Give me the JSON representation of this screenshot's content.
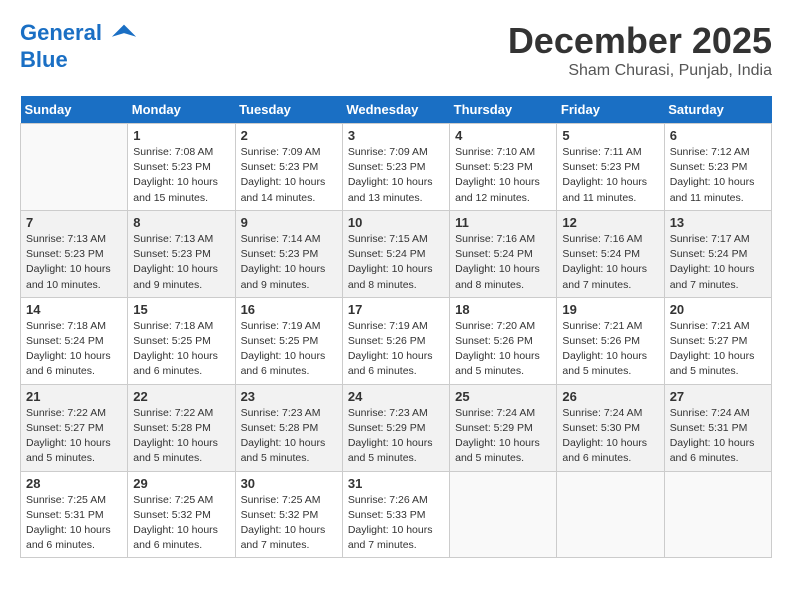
{
  "header": {
    "logo_line1": "General",
    "logo_line2": "Blue",
    "month": "December 2025",
    "location": "Sham Churasi, Punjab, India"
  },
  "days_of_week": [
    "Sunday",
    "Monday",
    "Tuesday",
    "Wednesday",
    "Thursday",
    "Friday",
    "Saturday"
  ],
  "weeks": [
    [
      {
        "num": "",
        "info": ""
      },
      {
        "num": "1",
        "info": "Sunrise: 7:08 AM\nSunset: 5:23 PM\nDaylight: 10 hours\nand 15 minutes."
      },
      {
        "num": "2",
        "info": "Sunrise: 7:09 AM\nSunset: 5:23 PM\nDaylight: 10 hours\nand 14 minutes."
      },
      {
        "num": "3",
        "info": "Sunrise: 7:09 AM\nSunset: 5:23 PM\nDaylight: 10 hours\nand 13 minutes."
      },
      {
        "num": "4",
        "info": "Sunrise: 7:10 AM\nSunset: 5:23 PM\nDaylight: 10 hours\nand 12 minutes."
      },
      {
        "num": "5",
        "info": "Sunrise: 7:11 AM\nSunset: 5:23 PM\nDaylight: 10 hours\nand 11 minutes."
      },
      {
        "num": "6",
        "info": "Sunrise: 7:12 AM\nSunset: 5:23 PM\nDaylight: 10 hours\nand 11 minutes."
      }
    ],
    [
      {
        "num": "7",
        "info": "Sunrise: 7:13 AM\nSunset: 5:23 PM\nDaylight: 10 hours\nand 10 minutes."
      },
      {
        "num": "8",
        "info": "Sunrise: 7:13 AM\nSunset: 5:23 PM\nDaylight: 10 hours\nand 9 minutes."
      },
      {
        "num": "9",
        "info": "Sunrise: 7:14 AM\nSunset: 5:23 PM\nDaylight: 10 hours\nand 9 minutes."
      },
      {
        "num": "10",
        "info": "Sunrise: 7:15 AM\nSunset: 5:24 PM\nDaylight: 10 hours\nand 8 minutes."
      },
      {
        "num": "11",
        "info": "Sunrise: 7:16 AM\nSunset: 5:24 PM\nDaylight: 10 hours\nand 8 minutes."
      },
      {
        "num": "12",
        "info": "Sunrise: 7:16 AM\nSunset: 5:24 PM\nDaylight: 10 hours\nand 7 minutes."
      },
      {
        "num": "13",
        "info": "Sunrise: 7:17 AM\nSunset: 5:24 PM\nDaylight: 10 hours\nand 7 minutes."
      }
    ],
    [
      {
        "num": "14",
        "info": "Sunrise: 7:18 AM\nSunset: 5:24 PM\nDaylight: 10 hours\nand 6 minutes."
      },
      {
        "num": "15",
        "info": "Sunrise: 7:18 AM\nSunset: 5:25 PM\nDaylight: 10 hours\nand 6 minutes."
      },
      {
        "num": "16",
        "info": "Sunrise: 7:19 AM\nSunset: 5:25 PM\nDaylight: 10 hours\nand 6 minutes."
      },
      {
        "num": "17",
        "info": "Sunrise: 7:19 AM\nSunset: 5:26 PM\nDaylight: 10 hours\nand 6 minutes."
      },
      {
        "num": "18",
        "info": "Sunrise: 7:20 AM\nSunset: 5:26 PM\nDaylight: 10 hours\nand 5 minutes."
      },
      {
        "num": "19",
        "info": "Sunrise: 7:21 AM\nSunset: 5:26 PM\nDaylight: 10 hours\nand 5 minutes."
      },
      {
        "num": "20",
        "info": "Sunrise: 7:21 AM\nSunset: 5:27 PM\nDaylight: 10 hours\nand 5 minutes."
      }
    ],
    [
      {
        "num": "21",
        "info": "Sunrise: 7:22 AM\nSunset: 5:27 PM\nDaylight: 10 hours\nand 5 minutes."
      },
      {
        "num": "22",
        "info": "Sunrise: 7:22 AM\nSunset: 5:28 PM\nDaylight: 10 hours\nand 5 minutes."
      },
      {
        "num": "23",
        "info": "Sunrise: 7:23 AM\nSunset: 5:28 PM\nDaylight: 10 hours\nand 5 minutes."
      },
      {
        "num": "24",
        "info": "Sunrise: 7:23 AM\nSunset: 5:29 PM\nDaylight: 10 hours\nand 5 minutes."
      },
      {
        "num": "25",
        "info": "Sunrise: 7:24 AM\nSunset: 5:29 PM\nDaylight: 10 hours\nand 5 minutes."
      },
      {
        "num": "26",
        "info": "Sunrise: 7:24 AM\nSunset: 5:30 PM\nDaylight: 10 hours\nand 6 minutes."
      },
      {
        "num": "27",
        "info": "Sunrise: 7:24 AM\nSunset: 5:31 PM\nDaylight: 10 hours\nand 6 minutes."
      }
    ],
    [
      {
        "num": "28",
        "info": "Sunrise: 7:25 AM\nSunset: 5:31 PM\nDaylight: 10 hours\nand 6 minutes."
      },
      {
        "num": "29",
        "info": "Sunrise: 7:25 AM\nSunset: 5:32 PM\nDaylight: 10 hours\nand 6 minutes."
      },
      {
        "num": "30",
        "info": "Sunrise: 7:25 AM\nSunset: 5:32 PM\nDaylight: 10 hours\nand 7 minutes."
      },
      {
        "num": "31",
        "info": "Sunrise: 7:26 AM\nSunset: 5:33 PM\nDaylight: 10 hours\nand 7 minutes."
      },
      {
        "num": "",
        "info": ""
      },
      {
        "num": "",
        "info": ""
      },
      {
        "num": "",
        "info": ""
      }
    ]
  ]
}
